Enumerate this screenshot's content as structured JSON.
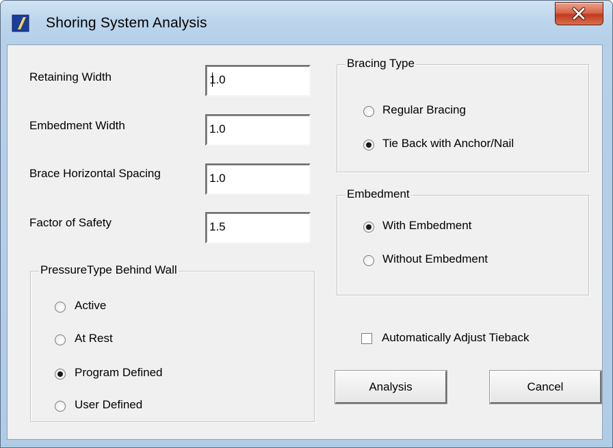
{
  "window": {
    "title": "Shoring System Analysis",
    "close_label": "X"
  },
  "fields": {
    "retaining_width": {
      "label": "Retaining Width",
      "value": "1.0"
    },
    "embedment_width": {
      "label": "Embedment Width",
      "value": "1.0"
    },
    "brace_horizontal_spacing": {
      "label": "Brace Horizontal Spacing",
      "value": "1.0"
    },
    "factor_of_safety": {
      "label": "Factor of Safety",
      "value": "1.5"
    }
  },
  "pressure_type": {
    "title": "PressureType Behind Wall",
    "options": [
      {
        "label": "Active",
        "selected": false
      },
      {
        "label": "At Rest",
        "selected": false
      },
      {
        "label": "Program Defined",
        "selected": true
      },
      {
        "label": "User Defined",
        "selected": false
      }
    ]
  },
  "bracing_type": {
    "title": "Bracing Type",
    "options": [
      {
        "label": "Regular Bracing",
        "selected": false
      },
      {
        "label": "Tie Back with Anchor/Nail",
        "selected": true
      }
    ]
  },
  "embedment": {
    "title": "Embedment",
    "options": [
      {
        "label": "With Embedment",
        "selected": true
      },
      {
        "label": "Without Embedment",
        "selected": false
      }
    ]
  },
  "auto_adjust": {
    "label": "Automatically Adjust Tieback",
    "checked": false
  },
  "buttons": {
    "analysis": "Analysis",
    "cancel": "Cancel"
  },
  "colors": {
    "title_bar": "#bcd5ec",
    "close_button": "#c13b1f",
    "dialog_face": "#f0f0f0"
  },
  "icons": {
    "app": "app-icon",
    "close": "close-icon"
  }
}
